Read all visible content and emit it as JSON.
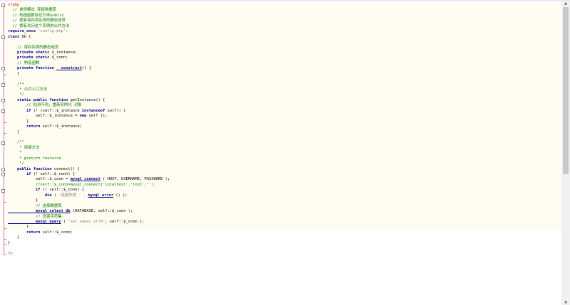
{
  "lines": [
    [
      {
        "t": "<?php",
        "c": "php"
      }
    ],
    [
      {
        "t": "  // 单例模式 连接数据库",
        "c": "cm"
      }
    ],
    [
      {
        "t": "  // 构造函数标记为非public",
        "c": "cm"
      }
    ],
    [
      {
        "t": "  // 拥有保存类实例的静态成员",
        "c": "cm"
      }
    ],
    [
      {
        "t": "  // 拥有访问这个实例的公共方法",
        "c": "cm"
      }
    ],
    [
      {
        "t": "require_once",
        "c": "kw"
      },
      {
        "t": " 'config.php';",
        "c": "str"
      }
    ],
    [
      {
        "t": "class",
        "c": "kw"
      },
      {
        "t": " Db {",
        "c": "plain"
      }
    ],
    [
      {
        "t": "",
        "c": "plain"
      }
    ],
    [
      {
        "t": "    // 保存实例的静态成员",
        "c": "cm"
      }
    ],
    [
      {
        "t": "    private static",
        "c": "kw"
      },
      {
        "t": " $_instance;",
        "c": "plain"
      }
    ],
    [
      {
        "t": "    private static",
        "c": "kw"
      },
      {
        "t": " $_conn;",
        "c": "plain"
      }
    ],
    [
      {
        "t": "    // 构造函数",
        "c": "cm"
      }
    ],
    [
      {
        "t": "    private function",
        "c": "kw"
      },
      {
        "t": " ",
        "c": "plain"
      },
      {
        "t": "__construct",
        "c": "fn"
      },
      {
        "t": "() {",
        "c": "plain"
      }
    ],
    [
      {
        "t": "    }",
        "c": "plain"
      }
    ],
    [
      {
        "t": "",
        "c": "plain"
      }
    ],
    [
      {
        "t": "    /**",
        "c": "cm"
      }
    ],
    [
      {
        "t": "     * 公共入口方法",
        "c": "cm"
      }
    ],
    [
      {
        "t": "     */",
        "c": "cm"
      }
    ],
    [
      {
        "t": "    static public function",
        "c": "kw"
      },
      {
        "t": " getInstance() {",
        "c": "plain"
      }
    ],
    [
      {
        "t": "        // 检测不到，重新实例化 对象",
        "c": "cm"
      }
    ],
    [
      {
        "t": "        if",
        "c": "kw"
      },
      {
        "t": " (! (self::$_instance ",
        "c": "plain"
      },
      {
        "t": "instanceof",
        "c": "kw"
      },
      {
        "t": " self)) {",
        "c": "plain"
      }
    ],
    [
      {
        "t": "            self::$_instance = ",
        "c": "plain"
      },
      {
        "t": "new",
        "c": "kw"
      },
      {
        "t": " self ();",
        "c": "plain"
      }
    ],
    [
      {
        "t": "        }",
        "c": "plain"
      }
    ],
    [
      {
        "t": "        return",
        "c": "kw"
      },
      {
        "t": " self::$_instance;",
        "c": "plain"
      }
    ],
    [
      {
        "t": "    }",
        "c": "plain"
      }
    ],
    [
      {
        "t": "",
        "c": "plain"
      }
    ],
    [
      {
        "t": "    /**",
        "c": "cm"
      }
    ],
    [
      {
        "t": "     * 连接方法",
        "c": "cm"
      }
    ],
    [
      {
        "t": "     *",
        "c": "cm"
      }
    ],
    [
      {
        "t": "     * @return resource",
        "c": "cm"
      }
    ],
    [
      {
        "t": "     */",
        "c": "cm"
      }
    ],
    [
      {
        "t": "    public function",
        "c": "kw"
      },
      {
        "t": " connect() {",
        "c": "plain"
      }
    ],
    [
      {
        "t": "        if",
        "c": "kw"
      },
      {
        "t": " (! self::$_conn) {",
        "c": "plain"
      }
    ],
    [
      {
        "t": "            self::$_conn = ",
        "c": "plain"
      },
      {
        "t": "mysql_connect",
        "c": "fn"
      },
      {
        "t": " ( HOST, USERNAME, PASSWORD );",
        "c": "plain"
      }
    ],
    [
      {
        "t": "            //self::$_conn=mysql_connect('localhost','root','');",
        "c": "cm"
      }
    ],
    [
      {
        "t": "            if",
        "c": "kw"
      },
      {
        "t": " (! self::$_conn) {",
        "c": "plain"
      }
    ],
    [
      {
        "t": "                die",
        "c": "kw"
      },
      {
        "t": " ( ",
        "c": "plain"
      },
      {
        "t": "'连接失败 '",
        "c": "str"
      },
      {
        "t": " . ",
        "c": "plain"
      },
      {
        "t": "mysql_error",
        "c": "fn"
      },
      {
        "t": " () );",
        "c": "plain"
      }
    ],
    [
      {
        "t": "            }",
        "c": "plain"
      }
    ],
    [
      {
        "t": "            // 选择数据库",
        "c": "cm"
      }
    ],
    [
      {
        "t": "            mysql_select_db",
        "c": "fn"
      },
      {
        "t": " (DATABASE, self::$_conn );",
        "c": "plain"
      }
    ],
    [
      {
        "t": "            // 设置字符集",
        "c": "cm"
      }
    ],
    [
      {
        "t": "            mysql_query",
        "c": "fn"
      },
      {
        "t": " ( ",
        "c": "plain"
      },
      {
        "t": "\"set names utf8\"",
        "c": "str"
      },
      {
        "t": ", self::$_conn );",
        "c": "plain"
      }
    ],
    [
      {
        "t": "        }",
        "c": "plain"
      }
    ],
    [
      {
        "t": "        return",
        "c": "kw"
      },
      {
        "t": " self::$_conn;",
        "c": "plain"
      }
    ],
    [
      {
        "t": "    }",
        "c": "plain"
      }
    ],
    [
      {
        "t": "}",
        "c": "plain"
      }
    ],
    [
      {
        "t": "",
        "c": "plain"
      }
    ],
    [
      {
        "t": "?>",
        "c": "php"
      }
    ]
  ],
  "fold_boxes": [
    0,
    6,
    12,
    15,
    18,
    20,
    26,
    31,
    32,
    35
  ],
  "colors": {
    "background": "#ffffff",
    "current_region": "#fffcf2",
    "keyword": "#00008b",
    "comment": "#008000",
    "string": "#808080",
    "php_tag": "#ff0000"
  },
  "icons": {
    "scroll_up": "arrow-up-icon",
    "scroll_down": "arrow-down-icon"
  }
}
